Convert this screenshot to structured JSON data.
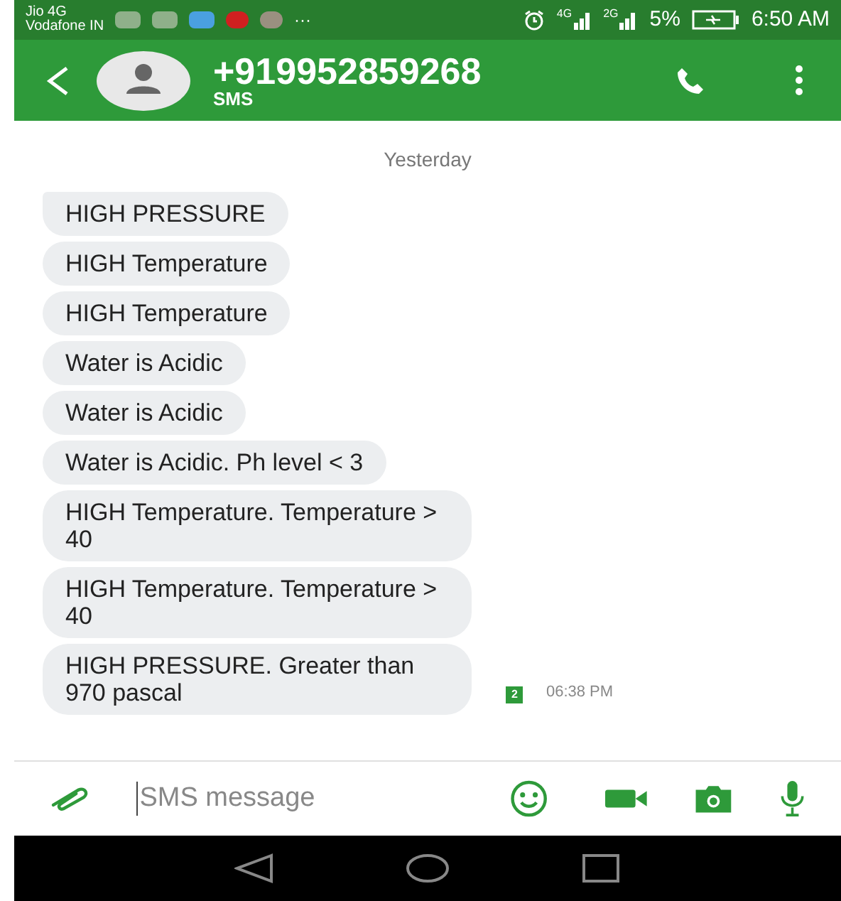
{
  "status_bar": {
    "carrier_1": "Jio 4G",
    "carrier_2": "Vodafone IN",
    "overflow": "···",
    "network_1": "4G",
    "network_2": "2G",
    "battery": "5%",
    "time": "6:50 AM"
  },
  "header": {
    "title": "+919952859268",
    "subtitle": "SMS"
  },
  "date_divider": "Yesterday",
  "messages": [
    {
      "text": "HIGH PRESSURE"
    },
    {
      "text": "HIGH Temperature"
    },
    {
      "text": "HIGH Temperature"
    },
    {
      "text": "Water is Acidic"
    },
    {
      "text": "Water is Acidic"
    },
    {
      "text": "Water is Acidic. Ph level < 3"
    },
    {
      "text": "HIGH Temperature. Temperature > 40"
    },
    {
      "text": "HIGH Temperature. Temperature > 40"
    },
    {
      "text": "HIGH PRESSURE. Greater than 970 pascal",
      "sim": "2",
      "time": "06:38 PM"
    }
  ],
  "composer": {
    "placeholder": "SMS message"
  }
}
